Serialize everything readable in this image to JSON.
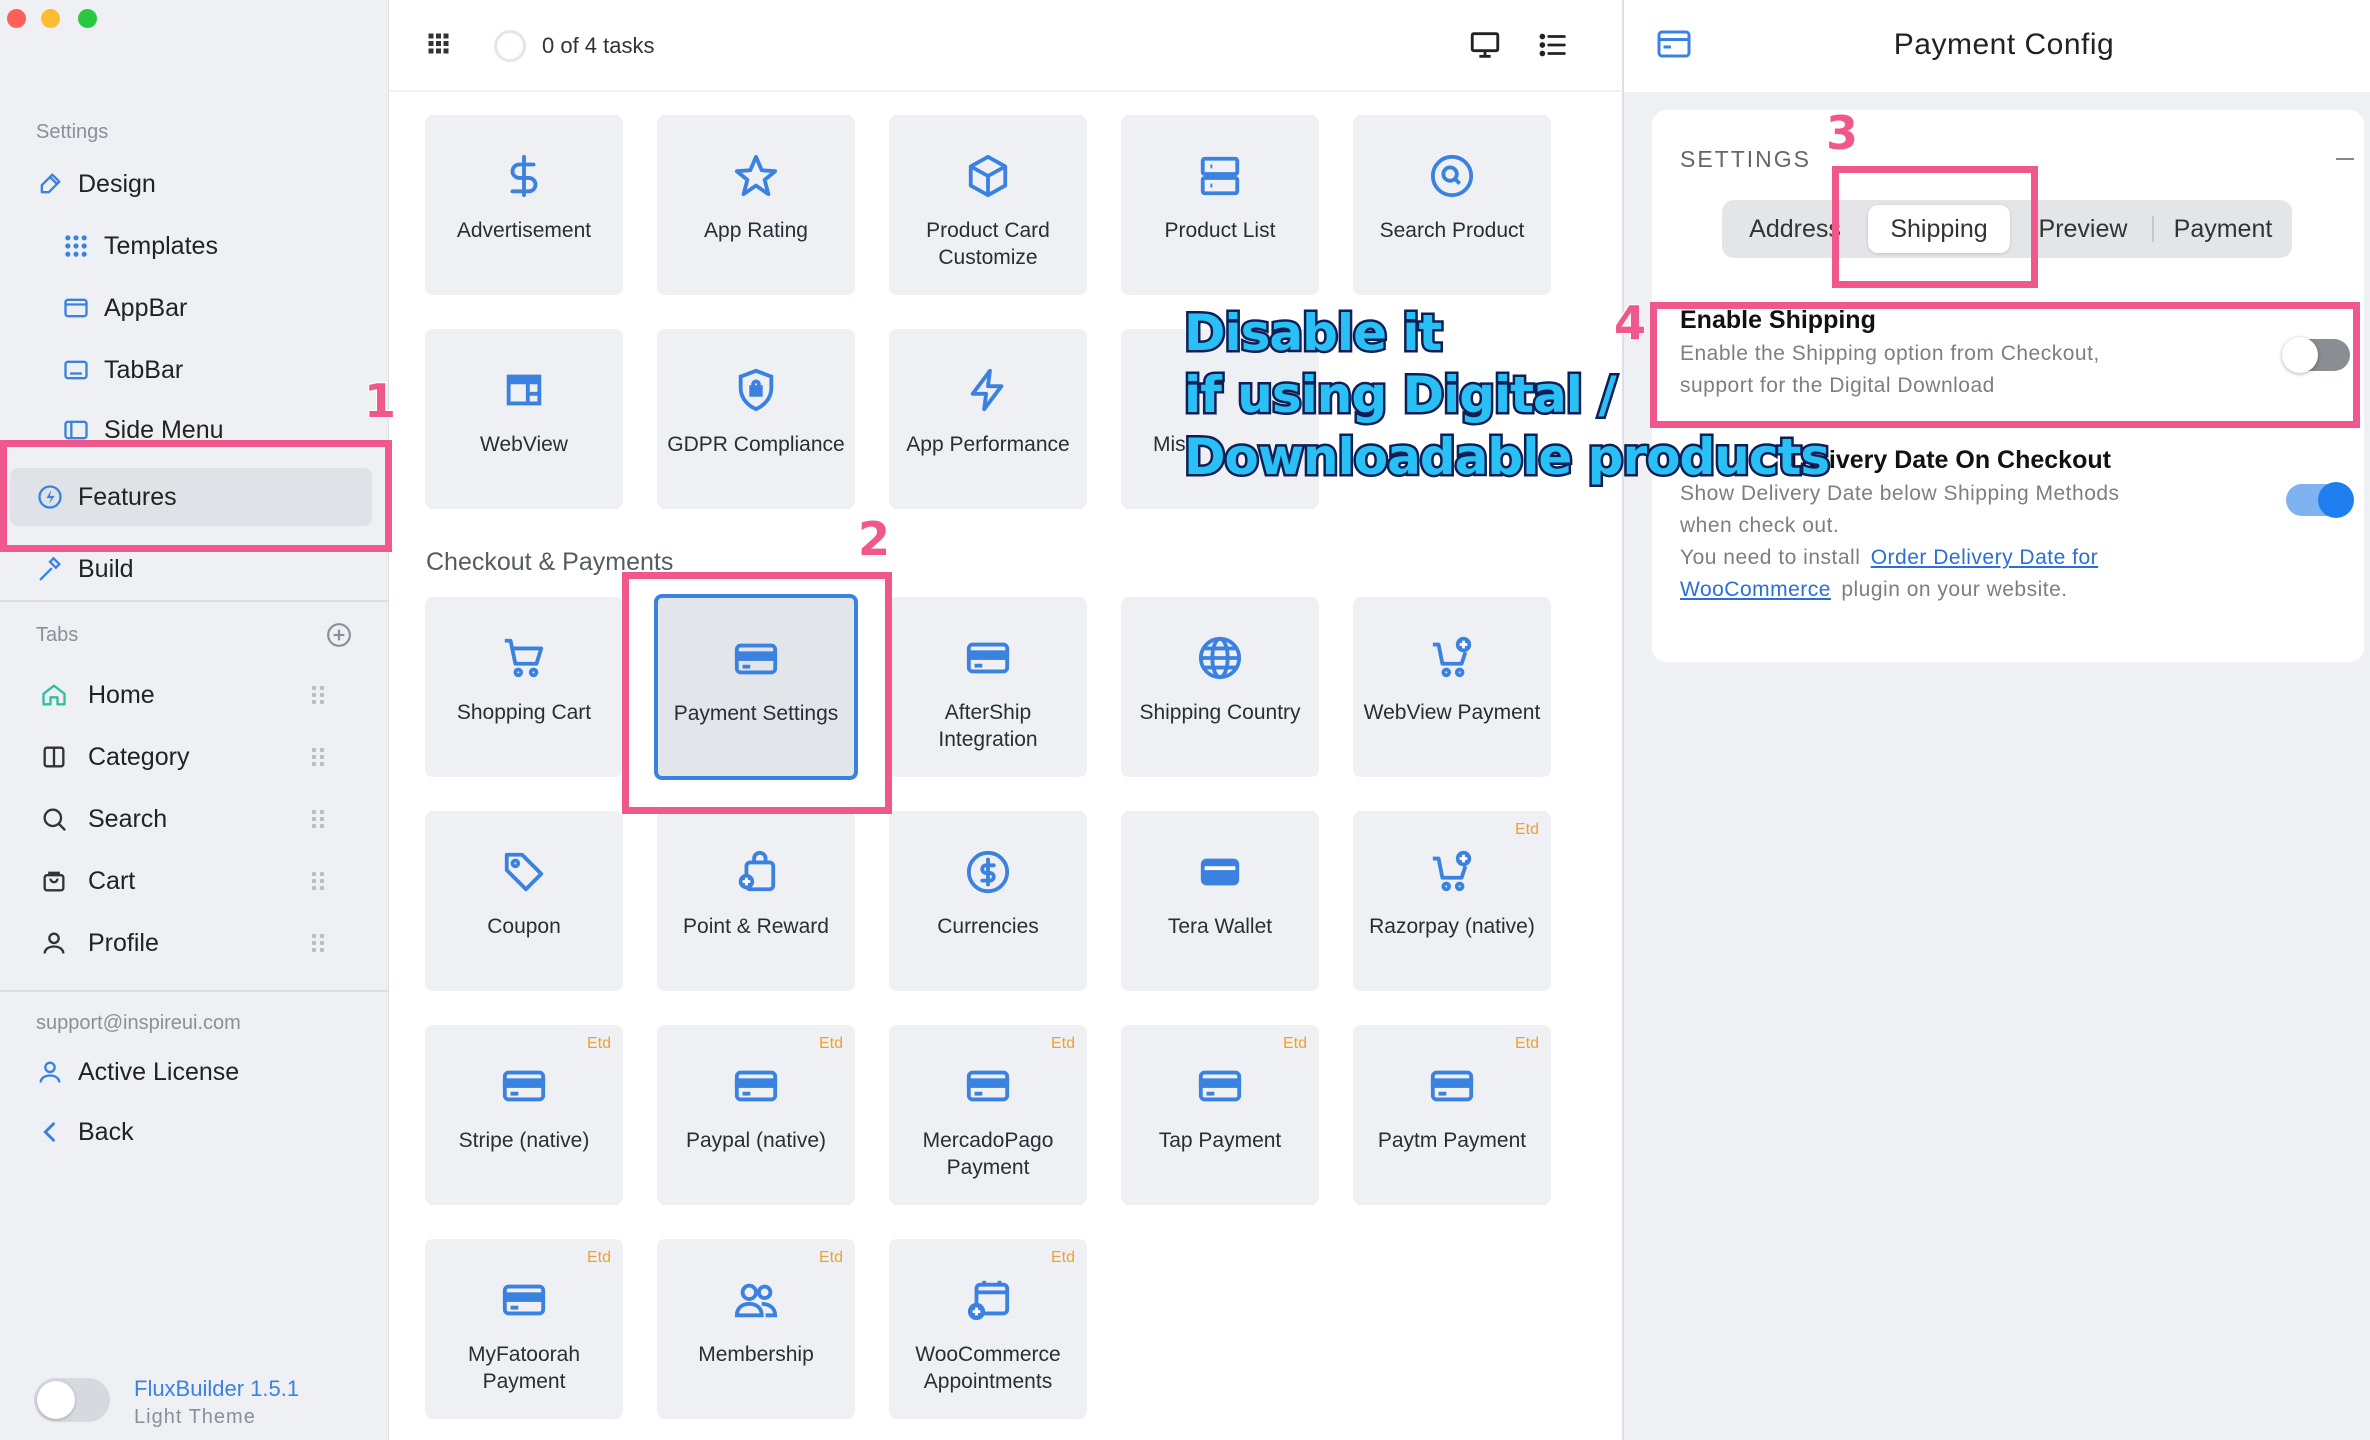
{
  "sidebar": {
    "settings_label": "Settings",
    "items": [
      {
        "label": "Design"
      },
      {
        "label": "Templates"
      },
      {
        "label": "AppBar"
      },
      {
        "label": "TabBar"
      },
      {
        "label": "Side Menu"
      },
      {
        "label": "Features"
      },
      {
        "label": "Build"
      }
    ],
    "tabs_label": "Tabs",
    "tabs": [
      {
        "label": "Home"
      },
      {
        "label": "Category"
      },
      {
        "label": "Search"
      },
      {
        "label": "Cart"
      },
      {
        "label": "Profile"
      }
    ],
    "support_email": "support@inspireui.com",
    "active_license": "Active License",
    "back": "Back",
    "app_version": "FluxBuilder 1.5.1",
    "theme": "Light Theme"
  },
  "toolbar": {
    "tasks": "0 of 4 tasks"
  },
  "features": {
    "row1": [
      "Advertisement",
      "App Rating",
      "Product Card Customize",
      "Product List",
      "Search Product"
    ],
    "row2": [
      "WebView",
      "GDPR Compliance",
      "App Performance",
      "Mis"
    ],
    "section_checkout": "Checkout & Payments",
    "row3": [
      "Shopping Cart",
      "Payment Settings",
      "AfterShip Integration",
      "Shipping Country",
      "WebView Payment"
    ],
    "row4": [
      "Coupon",
      "Point & Reward",
      "Currencies",
      "Tera Wallet",
      "Razorpay (native)"
    ],
    "row5": [
      "Stripe (native)",
      "Paypal (native)",
      "MercadoPago Payment",
      "Tap Payment",
      "Paytm Payment"
    ],
    "row6": [
      "MyFatoorah Payment",
      "Membership",
      "WooCommerce Appointments"
    ],
    "badge": "Etd"
  },
  "panel": {
    "title": "Payment Config",
    "settings_label": "SETTINGS",
    "tabs": [
      "Address",
      "Shipping",
      "Preview",
      "Payment"
    ],
    "enable_shipping": {
      "title": "Enable Shipping",
      "desc_line1": "Enable the Shipping option from Checkout,",
      "desc_line2": "support for the Digital Download",
      "enabled": false
    },
    "delivery_date": {
      "title": "Delivery Date On Checkout",
      "desc_line1": "Show Delivery Date below Shipping Methods",
      "desc_line2": "when check out.",
      "desc_line3": "You need to install",
      "link_line1": "Order Delivery Date for",
      "link_line2": "WooCommerce",
      "desc_line4": "plugin on your website.",
      "enabled": true
    }
  },
  "annotations": {
    "n1": "1",
    "n2": "2",
    "n3": "3",
    "n4": "4",
    "overlay_line1": "Disable it",
    "overlay_line2": "if using Digital /",
    "overlay_line3": "Downloadable products"
  },
  "colors": {
    "accent": "#3b82e0",
    "highlight": "#f0578a",
    "overlay_text": "#29c0f5",
    "badge": "#f0a030",
    "toggle_on": "#1f7ff0"
  }
}
